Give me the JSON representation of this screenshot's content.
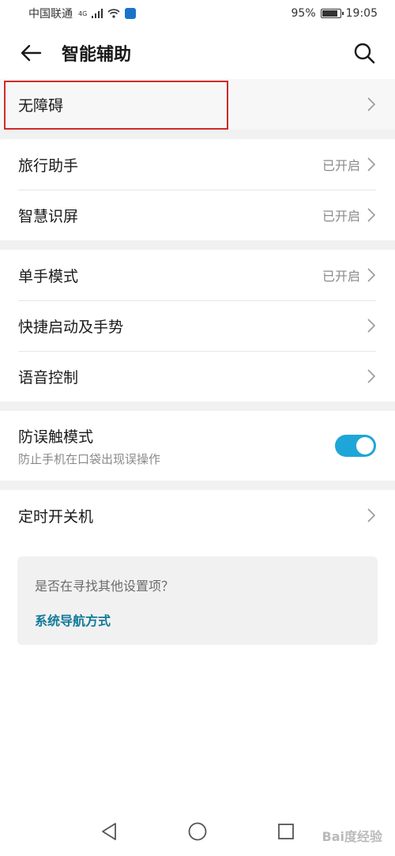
{
  "status_bar": {
    "carrier": "中国联通",
    "network": "4G",
    "battery": "95%",
    "time": "19:05"
  },
  "header": {
    "title": "智能辅助"
  },
  "groups": [
    [
      {
        "label": "无障碍",
        "status": ""
      }
    ],
    [
      {
        "label": "旅行助手",
        "status": "已开启"
      },
      {
        "label": "智慧识屏",
        "status": "已开启"
      }
    ],
    [
      {
        "label": "单手模式",
        "status": "已开启"
      },
      {
        "label": "快捷启动及手势",
        "status": ""
      },
      {
        "label": "语音控制",
        "status": ""
      }
    ]
  ],
  "toggle_row": {
    "label": "防误触模式",
    "subtitle": "防止手机在口袋出现误操作",
    "enabled": true
  },
  "timer_row": {
    "label": "定时开关机"
  },
  "suggestion_card": {
    "question": "是否在寻找其他设置项？",
    "link": "系统导航方式"
  },
  "watermark": "Bai度经验",
  "colors": {
    "accent": "#1ea6d8",
    "link": "#137a99",
    "highlight": "#d02a2a"
  }
}
